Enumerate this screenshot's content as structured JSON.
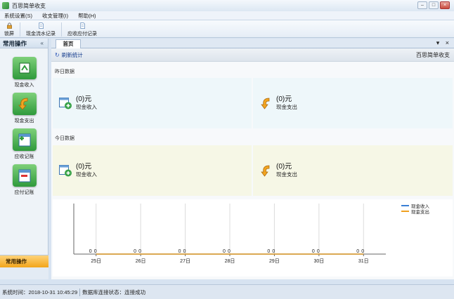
{
  "window": {
    "title": "百思简单收支",
    "minimize": "–",
    "maximize": "□",
    "close": "×"
  },
  "menu": [
    "系统设置(S)",
    "收支管理(I)",
    "帮助(H)"
  ],
  "toolbar": [
    {
      "label": "锁屏",
      "icon": "lock-icon"
    },
    {
      "label": "现金流水记录",
      "icon": "document-icon"
    },
    {
      "label": "应收应付记录",
      "icon": "document-icon"
    }
  ],
  "sidebar": {
    "title": "常用操作",
    "collapse": "«",
    "items": [
      {
        "label": "现金收入",
        "icon": "cash-income-icon"
      },
      {
        "label": "现金支出",
        "icon": "cash-expense-icon"
      },
      {
        "label": "应收记账",
        "icon": "receivable-icon"
      },
      {
        "label": "应付记账",
        "icon": "payable-icon"
      }
    ],
    "bottom_tab": "常用操作"
  },
  "tabs": {
    "home": "首页",
    "controls": "▾ ×"
  },
  "content": {
    "refresh_label": "刷新统计",
    "brand": "百思简单收支",
    "yesterday": {
      "title": "昨日数据",
      "income_amount": "(0)元",
      "income_label": "现金收入",
      "expense_amount": "(0)元",
      "expense_label": "现金支出"
    },
    "today": {
      "title": "今日数据",
      "income_amount": "(0)元",
      "income_label": "现金收入",
      "expense_amount": "(0)元",
      "expense_label": "现金支出"
    }
  },
  "chart_data": {
    "type": "line",
    "categories": [
      "25日",
      "26日",
      "27日",
      "28日",
      "29日",
      "30日",
      "31日"
    ],
    "series": [
      {
        "name": "现金收入",
        "values": [
          0,
          0,
          0,
          0,
          0,
          0,
          0
        ],
        "color": "#3a7fd5"
      },
      {
        "name": "现金支出",
        "values": [
          0,
          0,
          0,
          0,
          0,
          0,
          0
        ],
        "color": "#f0a020"
      }
    ],
    "grid": true,
    "legend": "top-right"
  },
  "status": {
    "time": "系统时间：2018-10-31 10:45:29",
    "db": "数据库连接状态：连接成功"
  }
}
